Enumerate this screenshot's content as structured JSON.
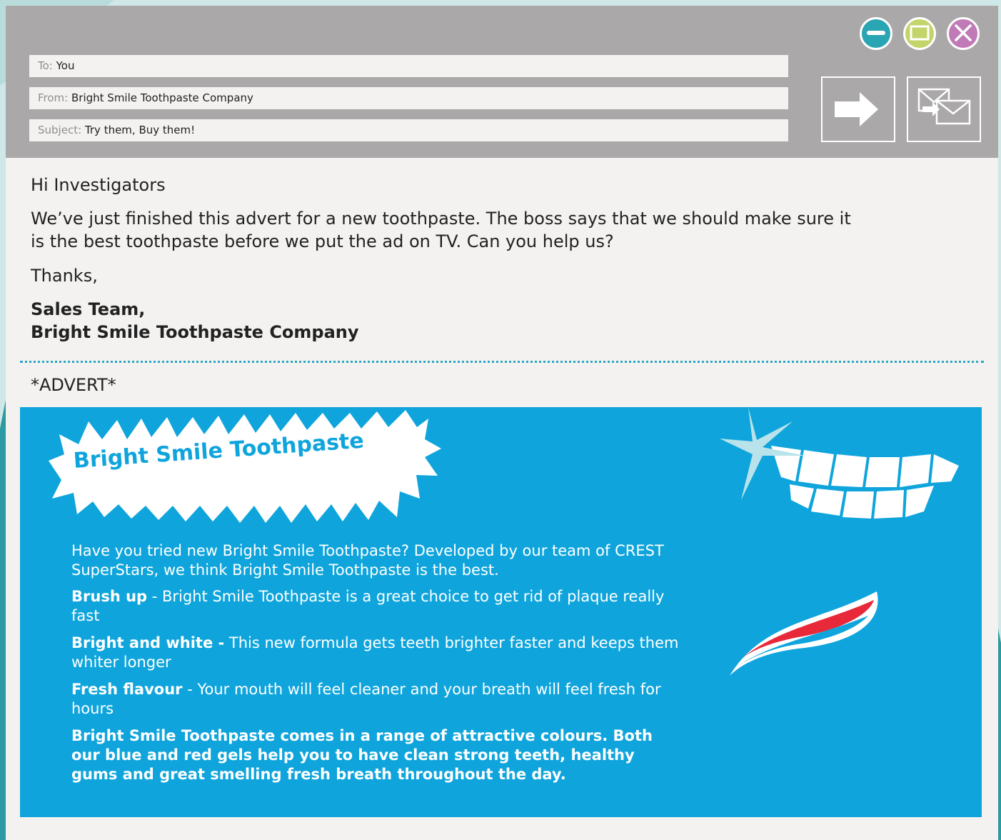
{
  "email": {
    "to_label": "To:",
    "to_value": "You",
    "from_label": "From:",
    "from_value": "Bright Smile Toothpaste Company",
    "subject_label": "Subject:",
    "subject_value": "Try them, Buy them!"
  },
  "window_controls": {
    "minimize_icon": "minus-circle",
    "maximize_icon": "square-circle",
    "close_icon": "x-circle",
    "minimize_color": "#2aa5b3",
    "maximize_color": "#c3d56a",
    "close_color": "#c07ab6"
  },
  "actions": {
    "forward_icon": "right-arrow",
    "reply_icon": "envelopes"
  },
  "message": {
    "greeting": "Hi Investigators",
    "paragraph_line1": "We’ve just finished this advert for a new toothpaste. The boss says that we should make sure it",
    "paragraph_line2": "is the best toothpaste before we put the ad on TV. Can you help us?",
    "thanks": "Thanks,",
    "signature_line1": "Sales Team,",
    "signature_line2": "Bright Smile Toothpaste Company"
  },
  "advert": {
    "tag": "*ADVERT*",
    "title": "Bright Smile Toothpaste",
    "intro": "Have you tried new Bright Smile Toothpaste? Developed by our team of CREST SuperStars, we think Bright Smile Toothpaste is the best.",
    "point1_head": "Brush up",
    "point1_text": " - Bright Smile Toothpaste is a great choice to get rid of plaque really fast",
    "point2_head": "Bright and white -",
    "point2_text": " This new formula gets teeth brighter faster and keeps them whiter longer",
    "point3_head": "Fresh flavour",
    "point3_text": " - Your mouth will feel cleaner and your breath will feel fresh for hours",
    "closing": "Bright Smile Toothpaste comes in a range of attractive colours. Both our blue and red gels help you to have clean strong teeth, healthy gums and great smelling fresh breath throughout the day.",
    "background_color": "#0fa5dc"
  }
}
